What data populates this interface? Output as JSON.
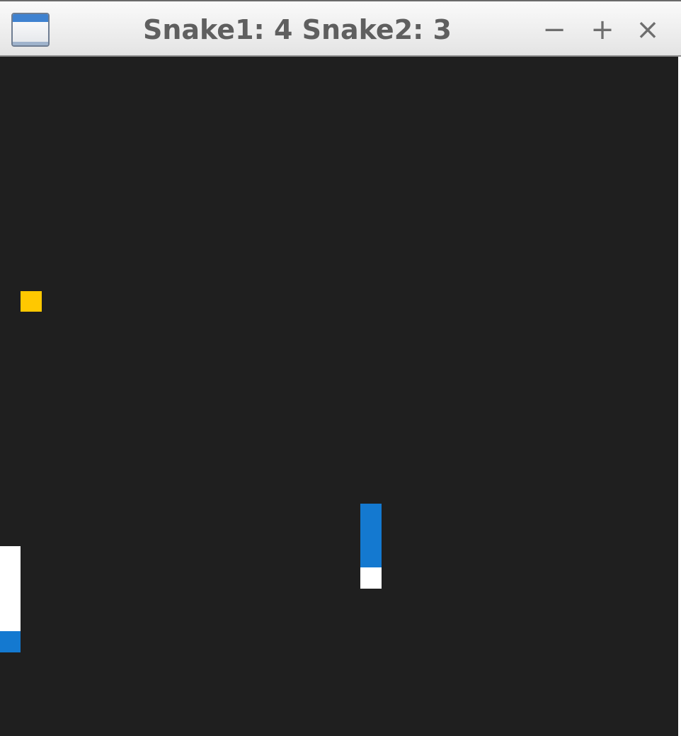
{
  "window": {
    "title": "Snake1: 4 Snake2: 3",
    "minimize_glyph": "−",
    "maximize_glyph": "+",
    "close_glyph": "×",
    "icon": "window-app-icon"
  },
  "game": {
    "background": "#1f1f1f",
    "colors": {
      "snake1_head": "#1479d0",
      "snake1_body": "#ffffff",
      "snake2_head": "#1479d0",
      "snake2_body": "#ffffff",
      "food": "#ffc800"
    },
    "scores": {
      "snake1": 4,
      "snake2": 3
    }
  }
}
